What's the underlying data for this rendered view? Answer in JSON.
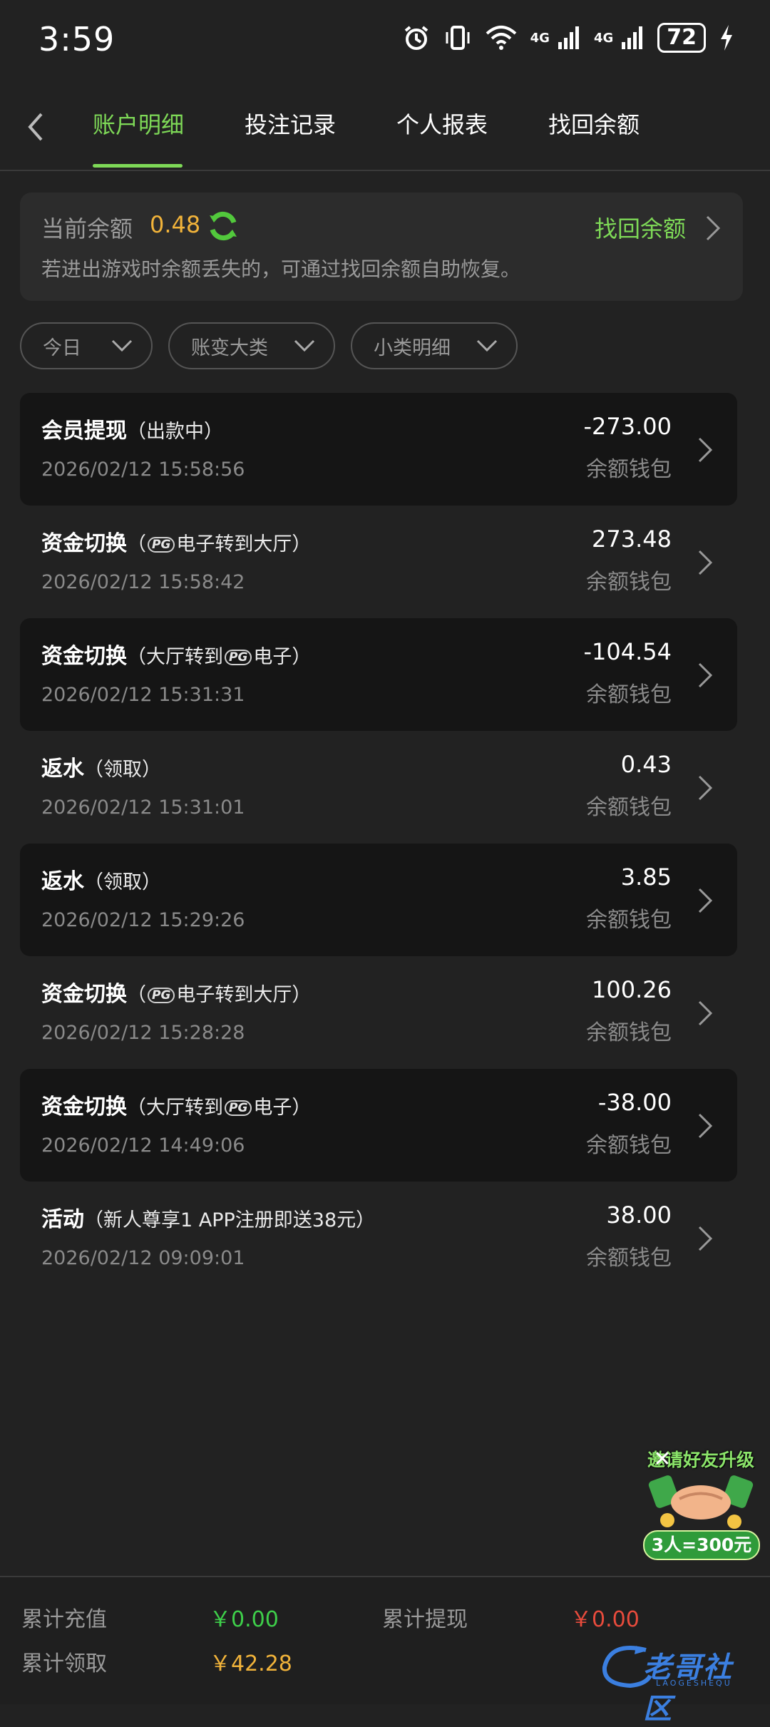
{
  "status_bar": {
    "time": "3:59",
    "network1": "4G",
    "network2": "4G",
    "battery": "72"
  },
  "tabs": [
    {
      "label": "账户明细",
      "active": true
    },
    {
      "label": "投注记录",
      "active": false
    },
    {
      "label": "个人报表",
      "active": false
    },
    {
      "label": "找回余额",
      "active": false
    }
  ],
  "balance": {
    "label": "当前余额",
    "value": "0.48",
    "retrieve_link": "找回余额",
    "description": "若进出游戏时余额丢失的，可通过找回余额自助恢复。"
  },
  "filters": [
    {
      "label": "今日"
    },
    {
      "label": "账变大类"
    },
    {
      "label": "小类明细"
    }
  ],
  "transactions": [
    {
      "title": "会员提现",
      "sub_before": "（出款中）",
      "pg": "",
      "sub_after": "",
      "time": "2026/02/12 15:58:56",
      "amount": "-273.00",
      "wallet": "余额钱包"
    },
    {
      "title": "资金切换",
      "sub_before": "（",
      "pg": "PG",
      "sub_after": "电子转到大厅）",
      "time": "2026/02/12 15:58:42",
      "amount": "273.48",
      "wallet": "余额钱包"
    },
    {
      "title": "资金切换",
      "sub_before": "（大厅转到",
      "pg": "PG",
      "sub_after": "电子）",
      "time": "2026/02/12 15:31:31",
      "amount": "-104.54",
      "wallet": "余额钱包"
    },
    {
      "title": "返水",
      "sub_before": "（领取）",
      "pg": "",
      "sub_after": "",
      "time": "2026/02/12 15:31:01",
      "amount": "0.43",
      "wallet": "余额钱包"
    },
    {
      "title": "返水",
      "sub_before": "（领取）",
      "pg": "",
      "sub_after": "",
      "time": "2026/02/12 15:29:26",
      "amount": "3.85",
      "wallet": "余额钱包"
    },
    {
      "title": "资金切换",
      "sub_before": "（",
      "pg": "PG",
      "sub_after": "电子转到大厅）",
      "time": "2026/02/12 15:28:28",
      "amount": "100.26",
      "wallet": "余额钱包"
    },
    {
      "title": "资金切换",
      "sub_before": "（大厅转到",
      "pg": "PG",
      "sub_after": "电子）",
      "time": "2026/02/12 14:49:06",
      "amount": "-38.00",
      "wallet": "余额钱包"
    },
    {
      "title": "活动",
      "sub_before": "（新人尊享1 APP注册即送38元）",
      "pg": "",
      "sub_after": "",
      "time": "2026/02/12 09:09:01",
      "amount": "38.00",
      "wallet": "余额钱包"
    }
  ],
  "promo": {
    "top_text": "邀请好友升级",
    "bottom_text": "3人=300元",
    "close_symbol": "✕"
  },
  "footer": {
    "recharge_label": "累计充值",
    "recharge_value": "￥0.00",
    "withdraw_label": "累计提现",
    "withdraw_value": "￥0.00",
    "claim_label": "累计领取",
    "claim_value": "￥42.28"
  },
  "watermark": {
    "text": "老哥社区",
    "sub": "LAOGESHEQU"
  },
  "colors": {
    "accent_green": "#7ed957",
    "amount_orange": "#f1b33a",
    "footer_green": "#3ecf4a",
    "footer_red": "#e84b3c"
  }
}
